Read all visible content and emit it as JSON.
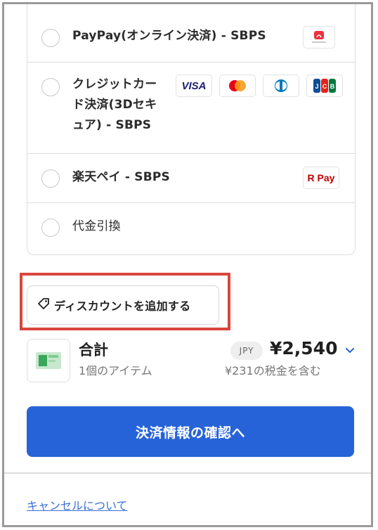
{
  "payment_methods": [
    {
      "label": "PayPay(オンライン決済) - SBPS",
      "logo": "paypay-logo",
      "logo_text": "PayPay"
    },
    {
      "label_lines": [
        "クレジットカー",
        "ド決済(3Dセキ",
        "ュア) - SBPS"
      ],
      "logos": [
        "VISA",
        "mastercard",
        "diners",
        "JCB"
      ]
    },
    {
      "label": "楽天ペイ - SBPS",
      "logo": "rakuten-pay-logo",
      "logo_text": "R Pay"
    },
    {
      "label": "代金引換"
    }
  ],
  "discount": {
    "label": "ディスカウントを追加する"
  },
  "summary": {
    "total_label": "合計",
    "items_text": "1個のアイテム",
    "currency": "JPY",
    "amount": "¥2,540",
    "tax_text": "¥231の税金を含む"
  },
  "confirm_button": {
    "label": "決済情報の確認へ"
  },
  "cancel_link": {
    "label": "キャンセルについて"
  },
  "colors": {
    "primary": "#2763d8",
    "highlight": "#d9463c",
    "link": "#3a6fd8"
  }
}
